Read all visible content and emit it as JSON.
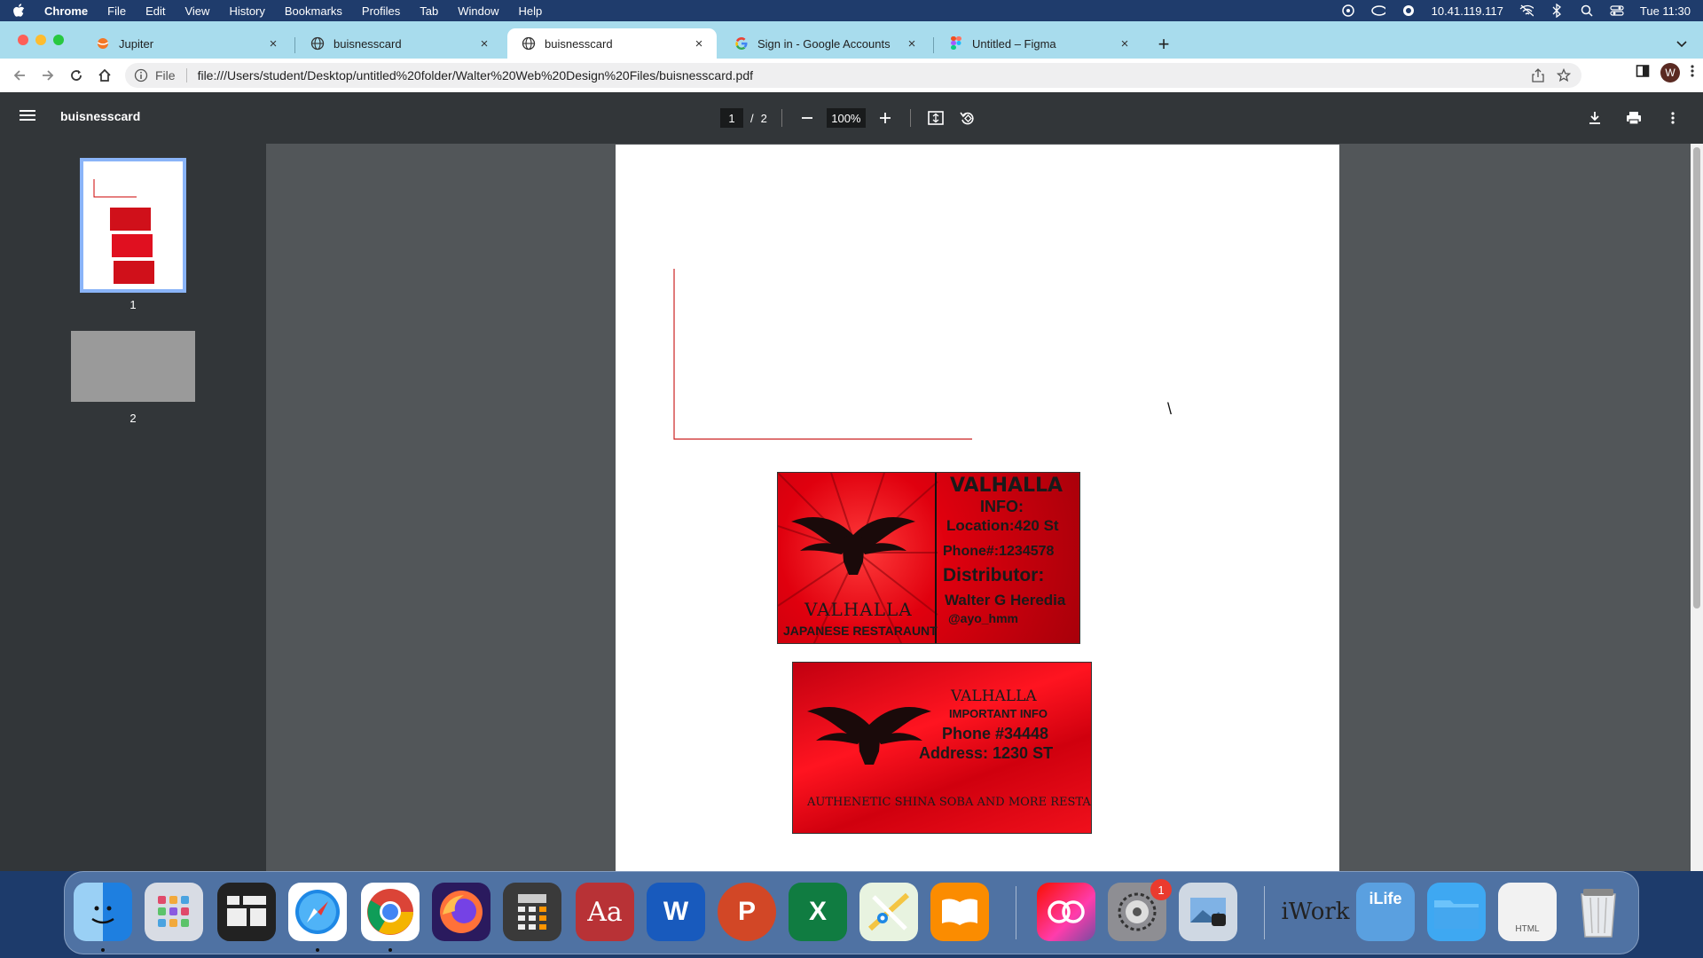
{
  "menubar": {
    "app_name": "Chrome",
    "items": [
      "File",
      "Edit",
      "View",
      "History",
      "Bookmarks",
      "Profiles",
      "Tab",
      "Window",
      "Help"
    ],
    "ip_address": "10.41.119.117",
    "clock": "Tue 11:30"
  },
  "tabs": [
    {
      "title": "Jupiter",
      "icon": "jupiter-icon"
    },
    {
      "title": "buisnesscard",
      "icon": "globe-icon"
    },
    {
      "title": "buisnesscard",
      "icon": "globe-icon"
    },
    {
      "title": "Sign in - Google Accounts",
      "icon": "google-icon"
    },
    {
      "title": "Untitled – Figma",
      "icon": "figma-icon"
    }
  ],
  "toolbar": {
    "scheme": "File",
    "url": "file:///Users/student/Desktop/untitled%20folder/Walter%20Web%20Design%20Files/buisnesscard.pdf",
    "profile_initial": "W"
  },
  "pdf": {
    "title": "buisnesscard",
    "current_page": "1",
    "page_separator": "/",
    "total_pages": "2",
    "zoom": "100%",
    "thumbnails": [
      "1",
      "2"
    ],
    "stray_mark": "\\"
  },
  "card1": {
    "title": "VALHALLA",
    "info": "INFO:",
    "location": "Location:420 St",
    "phone": "Phone#:1234578",
    "distributor": "Distributor:",
    "name": "Walter G Heredia",
    "handle": "@ayo_hmm",
    "brand": "VALHALLA",
    "subtitle": "JAPANESE RESTARAUNT"
  },
  "card2": {
    "title": "VALHALLA",
    "important": "IMPORTANT INFO",
    "phone": "Phone #34448",
    "address": "Address: 1230 ST",
    "tagline": "AUTHENETIC SHINA SOBA AND MORE RESTARAUNT"
  },
  "dock": {
    "apps": [
      "Finder",
      "Launchpad",
      "Mission Control",
      "Safari",
      "Chrome",
      "Firefox",
      "Calculator",
      "Dictionary",
      "Word",
      "PowerPoint",
      "Excel",
      "Maps",
      "Books",
      "Creative Cloud",
      "System Preferences",
      "Preview",
      "iWork",
      "iLife",
      "Folder",
      "HTML",
      "Trash"
    ],
    "settings_badge": "1",
    "word_label": "W",
    "powerpoint_label": "P",
    "excel_label": "X",
    "dictionary_label": "Aa",
    "iwork_label": "iWork",
    "ilife_label": "iLife",
    "html_label": "HTML"
  },
  "colors": {
    "menubar": "#1f3c6c",
    "tabstrip": "#a8dced",
    "pdf_toolbar": "#323639",
    "viewer_bg": "#525659",
    "card_red": "#e0000e",
    "accent_blue": "#8ab4f8"
  }
}
